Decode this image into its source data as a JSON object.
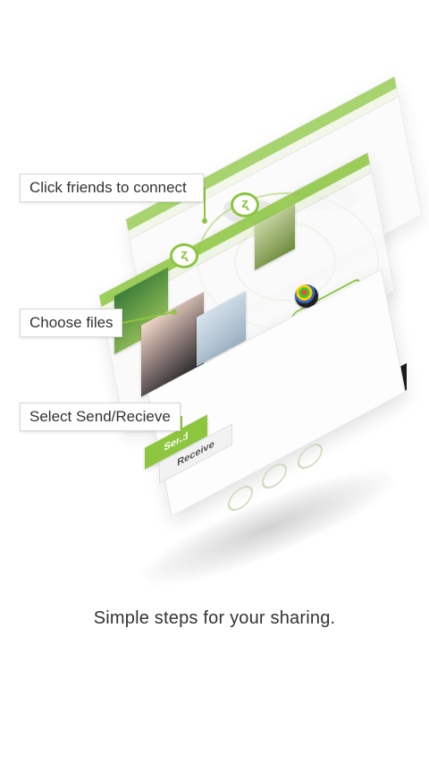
{
  "callouts": {
    "connect": "Click friends to connect",
    "choose": "Choose files",
    "send_receive": "Select Send/Recieve"
  },
  "buttons": {
    "send": "Send",
    "receive": "Receive"
  },
  "tagline": "Simple steps for your sharing.",
  "colors": {
    "accent": "#8cc63f",
    "text": "#333333",
    "background": "#ffffff"
  },
  "icons": [
    "app-logo-icon",
    "radar-rings-icon",
    "friend-avatar-icon",
    "step-icon"
  ]
}
